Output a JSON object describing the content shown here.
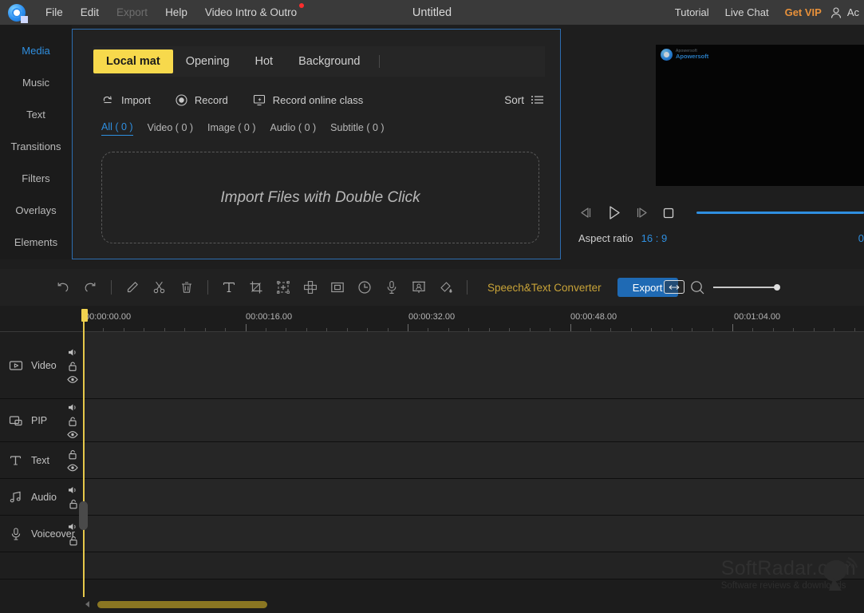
{
  "app": {
    "logo_icon": "film-reel-logo",
    "title": "Untitled"
  },
  "menu": {
    "items": [
      {
        "label": "File",
        "disabled": false,
        "badge": false
      },
      {
        "label": "Edit",
        "disabled": false,
        "badge": false
      },
      {
        "label": "Export",
        "disabled": true,
        "badge": false
      },
      {
        "label": "Help",
        "disabled": false,
        "badge": false
      },
      {
        "label": "Video Intro & Outro",
        "disabled": false,
        "badge": true
      }
    ]
  },
  "title_right": {
    "tutorial": "Tutorial",
    "live_chat": "Live Chat",
    "get_vip": "Get VIP",
    "get_vip_color": "#e8913a",
    "account": "Ac",
    "account_icon": "person-icon"
  },
  "sidebar": {
    "items": [
      {
        "label": "Media",
        "active": true
      },
      {
        "label": "Music",
        "active": false
      },
      {
        "label": "Text",
        "active": false
      },
      {
        "label": "Transitions",
        "active": false
      },
      {
        "label": "Filters",
        "active": false
      },
      {
        "label": "Overlays",
        "active": false
      },
      {
        "label": "Elements",
        "active": false
      }
    ],
    "active_color": "#2f8fe0"
  },
  "media_panel": {
    "category_tabs": [
      {
        "label": "Local mat",
        "active": true
      },
      {
        "label": "Opening",
        "active": false
      },
      {
        "label": "Hot",
        "active": false
      },
      {
        "label": "Background",
        "active": false
      }
    ],
    "active_tab_color": "#f7d94c",
    "tools": [
      {
        "label": "Import",
        "icon": "import-icon"
      },
      {
        "label": "Record",
        "icon": "record-icon"
      },
      {
        "label": "Record online class",
        "icon": "record-screen-icon"
      }
    ],
    "sort": {
      "label": "Sort",
      "icon": "sort-list-icon"
    },
    "filter_tabs": [
      {
        "label": "All ( 0 )",
        "active": true
      },
      {
        "label": "Video ( 0 )",
        "active": false
      },
      {
        "label": "Image ( 0 )",
        "active": false
      },
      {
        "label": "Audio ( 0 )",
        "active": false
      },
      {
        "label": "Subtitle ( 0 )",
        "active": false
      }
    ],
    "dropzone_text": "Import Files with Double Click"
  },
  "preview": {
    "watermark": {
      "line1": "Apowersoft",
      "line2": "Apowersoft",
      "icon": "film-reel-logo"
    },
    "controls": [
      {
        "name": "previous-frame",
        "icon": "prev-frame-icon"
      },
      {
        "name": "play",
        "icon": "play-icon"
      },
      {
        "name": "next-frame",
        "icon": "next-frame-icon"
      },
      {
        "name": "stop",
        "icon": "stop-icon"
      }
    ],
    "aspect_label": "Aspect ratio",
    "aspect_value": "16 : 9",
    "time_readout": "0",
    "accent_color": "#2f8fe0"
  },
  "edit_toolbar": {
    "icons": [
      {
        "name": "undo-icon",
        "label": "Undo"
      },
      {
        "name": "redo-icon",
        "label": "Redo"
      },
      {
        "name": "edit-pencil-icon",
        "label": "Edit"
      },
      {
        "name": "split-scissors-icon",
        "label": "Split"
      },
      {
        "name": "delete-trash-icon",
        "label": "Delete"
      },
      {
        "name": "text-icon",
        "label": "Text"
      },
      {
        "name": "crop-icon",
        "label": "Crop"
      },
      {
        "name": "add-element-icon",
        "label": "Add element"
      },
      {
        "name": "mosaic-icon",
        "label": "Mosaic"
      },
      {
        "name": "pip-frame-icon",
        "label": "Picture in picture"
      },
      {
        "name": "speed-clock-icon",
        "label": "Speed"
      },
      {
        "name": "voiceover-mic-icon",
        "label": "Voiceover"
      },
      {
        "name": "green-screen-icon",
        "label": "Green screen"
      },
      {
        "name": "color-paint-icon",
        "label": "Color correction"
      }
    ],
    "speech_text_converter": "Speech&Text Converter",
    "speech_color": "#c8a338",
    "export_label": "Export",
    "export_color": "#1f6ab4",
    "zoom_out_icon": "zoom-out-icon"
  },
  "timeline": {
    "ruler_labels": [
      "00:00:00.00",
      "00:00:16.00",
      "00:00:32.00",
      "00:01:04.00",
      "00:00:48.00"
    ],
    "playhead_color": "#e6c84a",
    "tracks": [
      {
        "name": "Video",
        "icon": "video-track-icon",
        "controls": [
          "speaker-icon",
          "lock-icon",
          "eye-icon"
        ]
      },
      {
        "name": "PIP",
        "icon": "pip-track-icon",
        "controls": [
          "speaker-icon",
          "lock-icon",
          "eye-icon"
        ]
      },
      {
        "name": "Text",
        "icon": "text-track-icon",
        "controls": [
          "lock-icon",
          "eye-icon"
        ]
      },
      {
        "name": "Audio",
        "icon": "audio-track-icon",
        "controls": [
          "speaker-icon",
          "lock-icon"
        ]
      },
      {
        "name": "Voiceover",
        "icon": "voiceover-track-icon",
        "controls": [
          "speaker-icon",
          "lock-icon"
        ]
      }
    ]
  },
  "watermark": {
    "main": "SoftRadar.com",
    "sub": "Software reviews & downloads",
    "icon": "satellite-dish-icon"
  }
}
